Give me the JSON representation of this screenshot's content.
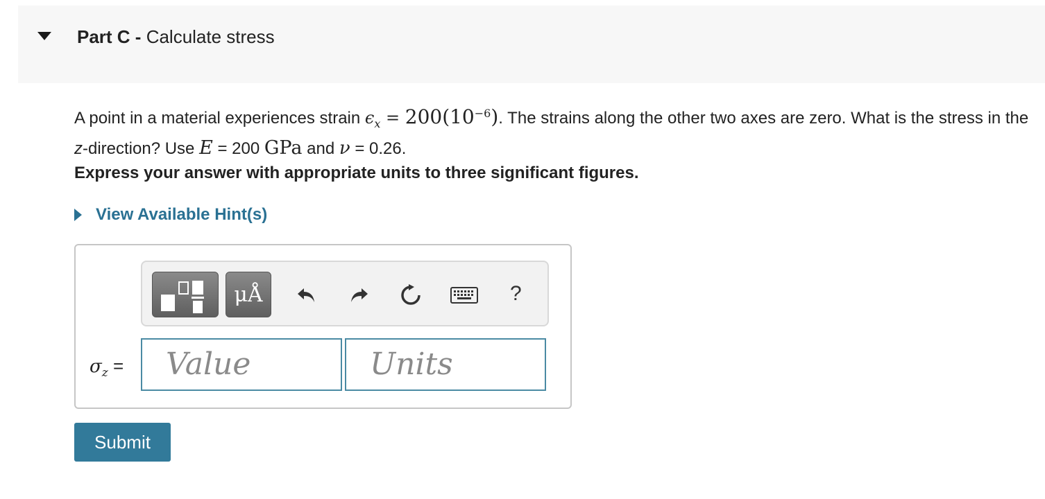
{
  "part": {
    "label": "Part C",
    "separator": " - ",
    "title": "Calculate stress"
  },
  "question": {
    "text1": "A point in a material experiences strain ",
    "strain_symbol": "ϵ",
    "strain_sub": "x",
    "equals": " = ",
    "strain_value": "200(10",
    "strain_exp": "−6",
    "strain_close": ")",
    "text2": ". The strains along the other two axes are zero. What is the stress in the ",
    "z_italic": "z",
    "text3": "-direction? Use ",
    "E_symbol": "E",
    "E_value": " = 200 ",
    "E_unit": "GPa",
    "and_text": " and ",
    "nu_symbol": "ν",
    "nu_value": " = 0.26."
  },
  "instruction": "Express your answer with appropriate units to three significant figures.",
  "hint": {
    "label": "View Available Hint(s)"
  },
  "toolbar": {
    "symbols_label": "μÅ",
    "help_label": "?"
  },
  "answer": {
    "sigma_symbol": "σ",
    "sigma_sub": "z",
    "equals": " =",
    "value_placeholder": "Value",
    "units_placeholder": "Units"
  },
  "submit_label": "Submit",
  "colors": {
    "link": "#2a7193",
    "submit_bg": "#327a9a",
    "field_border": "#4a8aa3",
    "header_bg": "#f7f7f7"
  }
}
